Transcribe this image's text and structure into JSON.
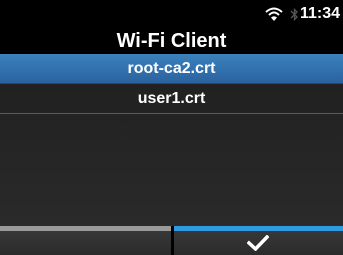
{
  "status": {
    "time": "11:34",
    "wifi_icon": "wifi-icon",
    "bluetooth_icon": "bluetooth-icon"
  },
  "header": {
    "title": "Wi-Fi Client"
  },
  "list": {
    "items": [
      {
        "label": "root-ca2.crt",
        "selected": true
      },
      {
        "label": "user1.crt",
        "selected": false
      }
    ]
  },
  "softkeys": {
    "left": {
      "label": ""
    },
    "right": {
      "icon": "checkmark-icon"
    }
  },
  "colors": {
    "selection": "#3b82bd",
    "accent": "#2f9ae2",
    "background": "#000000"
  }
}
